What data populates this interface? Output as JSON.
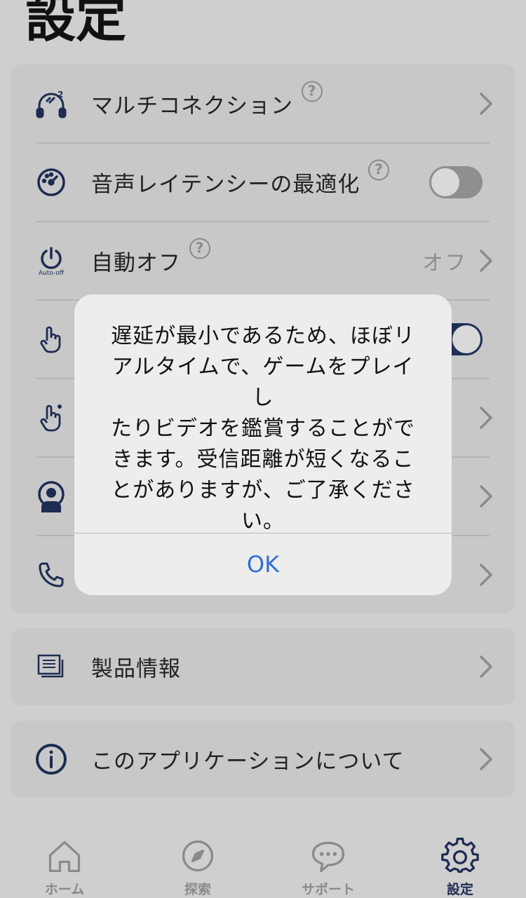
{
  "page_title": "設定",
  "settings": {
    "multi_connection": {
      "label": "マルチコネクション",
      "help": "?"
    },
    "latency": {
      "label": "音声レイテンシーの最適化",
      "help": "?",
      "enabled": false
    },
    "auto_off": {
      "label": "自動オフ",
      "help": "?",
      "value": "オフ",
      "icon_caption": "Auto-off"
    },
    "touch_control": {
      "enabled": true
    }
  },
  "product_info": {
    "label": "製品情報"
  },
  "about": {
    "label": "このアプリケーションについて"
  },
  "dialog": {
    "lines": [
      "遅延が最小であるため、ほぼリ",
      "アルタイムで、ゲームをプレイし",
      "たりビデオを鑑賞することがで",
      "きます。受信距離が短くなるこ",
      "とがありますが、ご了承くださ",
      "い。"
    ],
    "ok_label": "OK"
  },
  "tabs": [
    {
      "label": "ホーム",
      "icon": "home-icon"
    },
    {
      "label": "探索",
      "icon": "compass-icon"
    },
    {
      "label": "サポート",
      "icon": "chat-icon"
    },
    {
      "label": "設定",
      "icon": "gear-icon",
      "active": true
    }
  ],
  "colors": {
    "accent": "#1e2b52",
    "link": "#2f6fd0",
    "background": "#cfcfcf",
    "card": "#c8c8c8"
  }
}
